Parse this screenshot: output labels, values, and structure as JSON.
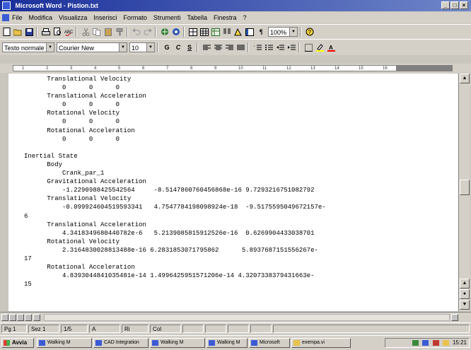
{
  "window": {
    "title": "Microsoft Word - Pistion.txt",
    "buttons": {
      "minimize": "_",
      "maximize": "□",
      "close": "×"
    }
  },
  "menu": {
    "items": [
      "File",
      "Modifica",
      "Visualizza",
      "Inserisci",
      "Formato",
      "Strumenti",
      "Tabella",
      "Finestra",
      "?"
    ]
  },
  "toolbar": {
    "zoom": "100%"
  },
  "format_bar": {
    "style": "Testo normale",
    "font": "Courier New",
    "size": "10",
    "bold": "G",
    "italic": "C",
    "underline": "S"
  },
  "ruler": {
    "ticks": [
      "1",
      "2",
      "3",
      "4",
      "5",
      "6",
      "7",
      "8",
      "9",
      "10",
      "11",
      "12",
      "13",
      "14",
      "15",
      "16"
    ]
  },
  "document": {
    "lines": [
      "      Translational Velocity",
      "          0      0      0",
      "      Translational Acceleration",
      "          0      0      0",
      "      Rotational Velocity",
      "          0      0      0",
      "      Rotational Acceleration",
      "          0      0      0",
      "",
      "Inertial State",
      "      Body",
      "          Crank_par_1",
      "      Gravitational Acceleration",
      "          -1.2290988425542564     -8.5147860760456868e-16 9.7293216751082792",
      "      Translational Velocity",
      "          -0.099924604519593341   4.7547784198098924e-18  -9.5175595049672157e-",
      "6",
      "      Translational Acceleration",
      "          4.3418349680440782e-6   5.2139085815912526e-16  0.6269904433038701",
      "      Rotational Velocity",
      "          2.3164830028813488e-16 6.2831853071795862      5.8937687151556267e-",
      "17",
      "      Rotational Acceleration",
      "          4.8393044841035481e-14 1.4996425951571206e-14 4.3207338379431663e-",
      "15"
    ]
  },
  "statusbar": {
    "page": "Pg 1",
    "section": "Sez 1",
    "pages": "1/5",
    "at": "A",
    "row": "Ri",
    "col": "Col"
  },
  "taskbar": {
    "start": "Avvia",
    "tasks": [
      "Walking M",
      "CAD Integration",
      "Walking M",
      "Walking M",
      "Microsoft",
      "exempa.vi"
    ],
    "clock": "15:21"
  },
  "colors": {
    "titlebar": "#1a2f9a",
    "chrome": "#d4d0c8",
    "page": "#ffffff"
  }
}
